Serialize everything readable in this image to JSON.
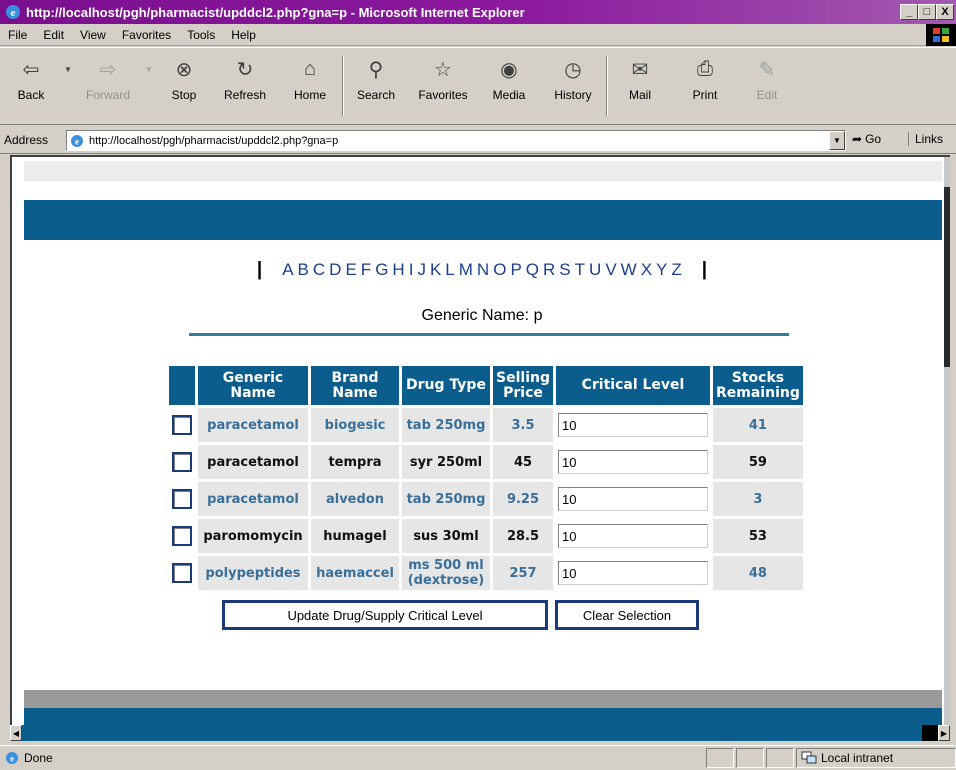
{
  "window": {
    "title": "http://localhost/pgh/pharmacist/upddcl2.php?gna=p - Microsoft Internet Explorer",
    "controls": [
      "_",
      "□",
      "X"
    ]
  },
  "menu": [
    "File",
    "Edit",
    "View",
    "Favorites",
    "Tools",
    "Help"
  ],
  "toolbar": {
    "back": "Back",
    "forward": "Forward",
    "stop": "Stop",
    "refresh": "Refresh",
    "home": "Home",
    "search": "Search",
    "favorites": "Favorites",
    "media": "Media",
    "history": "History",
    "mail": "Mail",
    "print": "Print",
    "edit": "Edit"
  },
  "address": {
    "label": "Address",
    "url": "http://localhost/pgh/pharmacist/upddcl2.php?gna=p",
    "go": "Go",
    "links": "Links"
  },
  "page": {
    "alphabet": [
      "A",
      "B",
      "C",
      "D",
      "E",
      "F",
      "G",
      "H",
      "I",
      "J",
      "K",
      "L",
      "M",
      "N",
      "O",
      "P",
      "Q",
      "R",
      "S",
      "T",
      "U",
      "V",
      "W",
      "X",
      "Y",
      "Z"
    ],
    "generic_name_label": "Generic Name: p",
    "table": {
      "headers": {
        "generic": "Generic Name",
        "brand": "Brand Name",
        "type": "Drug Type",
        "price": "Selling Price",
        "critical": "Critical Level",
        "stocks": "Stocks Remaining"
      },
      "rows": [
        {
          "generic": "paracetamol",
          "brand": "biogesic",
          "type": "tab 250mg",
          "price": "3.5",
          "critical": "10",
          "stocks": "41"
        },
        {
          "generic": "paracetamol",
          "brand": "tempra",
          "type": "syr 250ml",
          "price": "45",
          "critical": "10",
          "stocks": "59"
        },
        {
          "generic": "paracetamol",
          "brand": "alvedon",
          "type": "tab 250mg",
          "price": "9.25",
          "critical": "10",
          "stocks": "3"
        },
        {
          "generic": "paromomycin",
          "brand": "humagel",
          "type": "sus 30ml",
          "price": "28.5",
          "critical": "10",
          "stocks": "53"
        },
        {
          "generic": "polypeptides",
          "brand": "haemaccel",
          "type": "ms 500 ml (dextrose)",
          "price": "257",
          "critical": "10",
          "stocks": "48"
        }
      ]
    },
    "buttons": {
      "update": "Update Drug/Supply Critical Level",
      "clear": "Clear Selection"
    }
  },
  "status": {
    "text": "Done",
    "zone": "Local intranet"
  },
  "colors": {
    "titlebar": "#8c1a9e",
    "brand_blue": "#0b5d8e",
    "link_blue": "#1b3f8f"
  }
}
